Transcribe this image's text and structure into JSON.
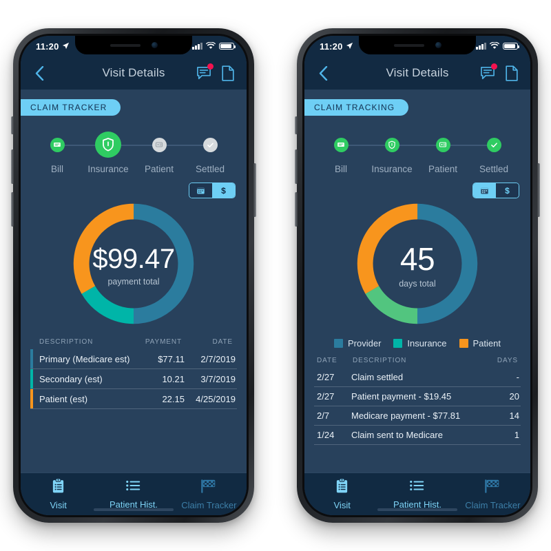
{
  "colors": {
    "provider_blue": "#2b7c9e",
    "insurance_teal": "#00b5a8",
    "insurance_green": "#52c57f",
    "patient_orange": "#f8951d",
    "accent_light_blue": "#6ecff5",
    "step_green": "#2fcc62",
    "step_gray": "#d6dadd",
    "badge_red": "#f5124f",
    "screen_bg": "#28415c",
    "header_bg": "#122a42",
    "tabbar_bg": "#112a42"
  },
  "phones": [
    {
      "status_bar": {
        "time": "11:20",
        "location_icon": "location-arrow-icon",
        "signal_icon": "signal-bars-icon",
        "wifi_icon": "wifi-icon",
        "battery_icon": "battery-icon"
      },
      "header": {
        "back_icon": "chevron-left-icon",
        "title": "Visit Details",
        "message_icon": "message-bubble-icon",
        "document_icon": "document-icon",
        "badge_visible": true
      },
      "section_label": "CLAIM TRACKER",
      "stepper": [
        {
          "label": "Bill",
          "icon": "bill-icon",
          "state": "complete",
          "size": "small"
        },
        {
          "label": "Insurance",
          "icon": "shield-icon",
          "state": "active",
          "size": "large"
        },
        {
          "label": "Patient",
          "icon": "id-card-icon",
          "state": "pending",
          "size": "small"
        },
        {
          "label": "Settled",
          "icon": "check-icon",
          "state": "pending",
          "size": "small"
        }
      ],
      "toggle": {
        "calendar_label": "calendar-icon",
        "money_label": "$",
        "active": "money"
      },
      "donut": {
        "value": "$99.47",
        "caption": "payment total"
      },
      "legend": [],
      "table": {
        "headers": [
          "DESCRIPTION",
          "PAYMENT",
          "DATE"
        ],
        "rows": [
          {
            "bar": "#2b7c9e",
            "description": "Primary (Medicare est)",
            "payment": "$77.11",
            "date": "2/7/2019"
          },
          {
            "bar": "#00b5a8",
            "description": "Secondary (est)",
            "payment": "10.21",
            "date": "3/7/2019"
          },
          {
            "bar": "#f8951d",
            "description": "Patient (est)",
            "payment": "22.15",
            "date": "4/25/2019"
          }
        ]
      },
      "tabs": [
        {
          "label": "Visit",
          "icon": "clipboard-icon",
          "state": "on"
        },
        {
          "label": "Patient Hist.",
          "icon": "list-icon",
          "state": "on"
        },
        {
          "label": "Claim Tracker",
          "icon": "checkered-flag-icon",
          "state": "off"
        }
      ]
    },
    {
      "status_bar": {
        "time": "11:20",
        "location_icon": "location-arrow-icon",
        "signal_icon": "signal-bars-icon",
        "wifi_icon": "wifi-icon",
        "battery_icon": "battery-icon"
      },
      "header": {
        "back_icon": "chevron-left-icon",
        "title": "Visit Details",
        "message_icon": "message-bubble-icon",
        "document_icon": "document-icon",
        "badge_visible": true
      },
      "section_label": "CLAIM TRACKING",
      "stepper": [
        {
          "label": "Bill",
          "icon": "bill-icon",
          "state": "complete",
          "size": "small"
        },
        {
          "label": "Insurance",
          "icon": "shield-icon",
          "state": "complete",
          "size": "small"
        },
        {
          "label": "Patient",
          "icon": "id-card-icon",
          "state": "complete",
          "size": "small"
        },
        {
          "label": "Settled",
          "icon": "check-icon",
          "state": "complete",
          "size": "small"
        }
      ],
      "toggle": {
        "calendar_label": "calendar-icon",
        "money_label": "$",
        "active": "calendar"
      },
      "donut": {
        "value": "45",
        "caption": "days total"
      },
      "legend": [
        {
          "label": "Provider",
          "color": "#2b7c9e"
        },
        {
          "label": "Insurance",
          "color": "#00b5a8"
        },
        {
          "label": "Patient",
          "color": "#f8951d"
        }
      ],
      "table": {
        "headers": [
          "DATE",
          "DESCRIPTION",
          "DAYS"
        ],
        "rows": [
          {
            "date": "2/27",
            "description": "Claim settled",
            "days": "-"
          },
          {
            "date": "2/27",
            "description": "Patient payment - $19.45",
            "days": "20"
          },
          {
            "date": "2/7",
            "description": "Medicare payment - $77.81",
            "days": "14"
          },
          {
            "date": "1/24",
            "description": "Claim sent to Medicare",
            "days": "1"
          }
        ]
      },
      "tabs": [
        {
          "label": "Visit",
          "icon": "clipboard-icon",
          "state": "on"
        },
        {
          "label": "Patient Hist.",
          "icon": "list-icon",
          "state": "on"
        },
        {
          "label": "Claim Tracker",
          "icon": "checkered-flag-icon",
          "state": "off"
        }
      ]
    }
  ],
  "chart_data": [
    {
      "type": "pie",
      "title": "$99.47 payment total",
      "labels": [
        "Provider",
        "Insurance",
        "Patient"
      ],
      "values": [
        77.11,
        10.21,
        22.15
      ],
      "colors": [
        "#2b7c9e",
        "#00b5a8",
        "#f8951d"
      ],
      "angles_deg": [
        180,
        60,
        120
      ],
      "center_value": "$99.47",
      "center_caption": "payment total",
      "donut": true,
      "legend_position": "none"
    },
    {
      "type": "pie",
      "title": "45 days total",
      "labels": [
        "Provider",
        "Insurance",
        "Patient"
      ],
      "values": [
        22,
        9,
        14
      ],
      "colors": [
        "#2b7c9e",
        "#52c57f",
        "#f8951d"
      ],
      "angles_deg": [
        180,
        60,
        120
      ],
      "center_value": "45",
      "center_caption": "days total",
      "donut": true,
      "legend_position": "bottom"
    }
  ]
}
